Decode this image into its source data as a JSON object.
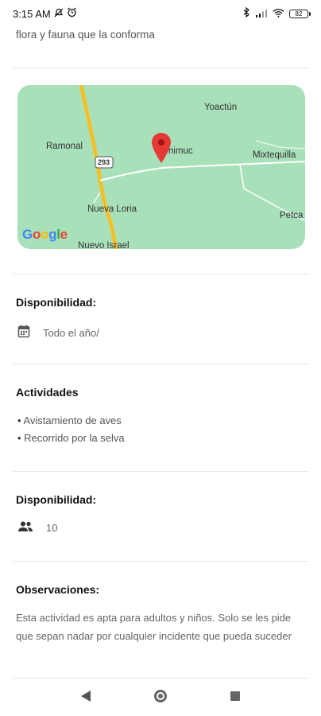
{
  "status_bar": {
    "time": "3:15 AM",
    "battery": "82"
  },
  "intro_text": "flora y fauna que la conforma",
  "map": {
    "places": {
      "yoactun": "Yoactún",
      "ramonal": "Ramonal",
      "road": "293",
      "town": "nimuc",
      "mixtequilla": "Mixtequilla",
      "nueva_loria": "Nueva Loria",
      "petca": "Petca",
      "nuevo_israel": "Nuevo Israel"
    },
    "logo": "Google"
  },
  "availability": {
    "title": "Disponibilidad:",
    "value": "Todo el año/",
    "icon": "calendar-icon"
  },
  "activities": {
    "title": "Actividades",
    "items": [
      "Avistamiento de aves",
      "Recorrido por la selva"
    ]
  },
  "capacity": {
    "title": "Disponibilidad:",
    "value": "10",
    "icon": "people-icon"
  },
  "observations": {
    "title": "Observaciones:",
    "text": "Esta actividad es apta para adultos y niños. Solo se les pide que sepan nadar por cualquier incidente que pueda suceder"
  },
  "colors": {
    "map_bg": "#a8e0b9",
    "road_yellow": "#f4c430",
    "marker_red": "#e53935"
  }
}
